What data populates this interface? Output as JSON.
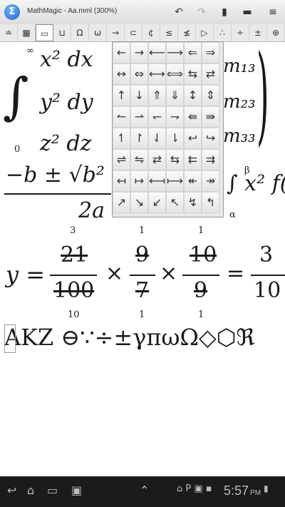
{
  "app": {
    "title": "MathMagic - Aa.mml (300%)"
  },
  "toolbar": [
    "↶",
    "↷",
    "▮",
    "▬",
    "≡"
  ],
  "symbols": [
    "≐",
    "▦",
    "▭",
    "⊔",
    "Ω",
    "ω",
    "→",
    "⊂",
    "¢",
    "≤",
    "≰",
    "▷",
    "∴",
    "÷",
    "±",
    "⊕"
  ],
  "palette": {
    "arrows": [
      "←",
      "→",
      "⟵",
      "⟶",
      "⇐",
      "⇒",
      "↔",
      "⇔",
      "⟷",
      "⟺",
      "⇆",
      "⇄",
      "↑",
      "↓",
      "⇑",
      "⇓",
      "↕",
      "⇕",
      "↼",
      "⇀",
      "↽",
      "⇁",
      "⇚",
      "⇛",
      "↿",
      "↾",
      "⇃",
      "⇂",
      "↩",
      "↪",
      "⇌",
      "⇋",
      "⇄",
      "⇆",
      "⇇",
      "⇉",
      "↤",
      "↦",
      "⟻",
      "⟼",
      "↞",
      "↠",
      "↗",
      "↘",
      "↙",
      "↖",
      "↯",
      "↰",
      "↝",
      "↜",
      "⇝",
      "⇜",
      "⊸",
      "⟜"
    ]
  },
  "math": {
    "integral_sup": "∞",
    "integral_sub": "0",
    "rows": [
      "x² dx",
      "y² dy",
      "z² dz"
    ],
    "matrix": [
      "m₁₃",
      "m₂₃",
      "m₃₃"
    ],
    "quadratic_num": "−b ± √b²",
    "quadratic_den": "2a",
    "int2": "∫ x² f(",
    "int2_sup": "β",
    "int2_sub": "α",
    "cancel": {
      "lhs": "y =",
      "f1": {
        "num": "21",
        "den": "100",
        "num_tag": "3",
        "den_tag": "10"
      },
      "f2": {
        "num": "9",
        "den": "7",
        "num_tag": "1",
        "den_tag": "1"
      },
      "f3": {
        "num": "10",
        "den": "9",
        "num_tag": "1",
        "den_tag": "1"
      },
      "times": "×",
      "eq": "=",
      "result_num": "3",
      "result_den": "10"
    },
    "glyphs": "AKZ ⊖∵÷±γπωΩ◇⬡ℜ"
  },
  "status": {
    "time": "5:57",
    "ampm": "PM"
  }
}
